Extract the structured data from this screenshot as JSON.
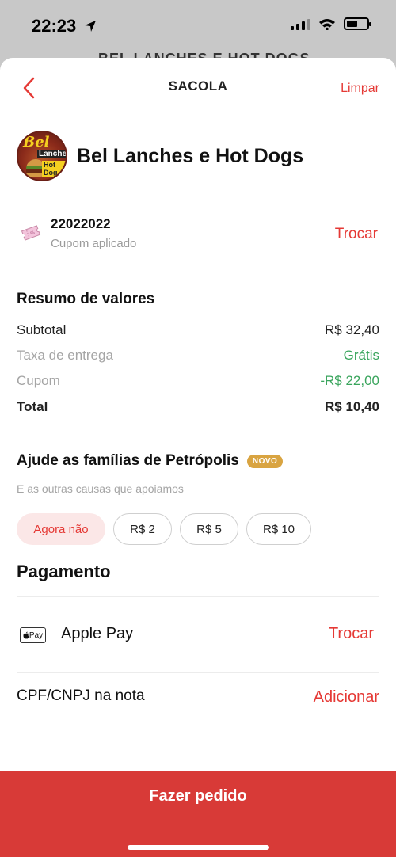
{
  "status_bar": {
    "time": "22:23"
  },
  "background_page": {
    "title": "BEL LANCHES E HOT DOGS"
  },
  "header": {
    "title": "SACOLA",
    "clear_label": "Limpar"
  },
  "store": {
    "name": "Bel Lanches e Hot Dogs",
    "logo_text": [
      "Bel",
      "Lanches",
      "Hot Dog"
    ]
  },
  "coupon": {
    "code": "22022022",
    "status": "Cupom aplicado",
    "change_label": "Trocar"
  },
  "summary": {
    "title": "Resumo de valores",
    "rows": [
      {
        "label": "Subtotal",
        "value": "R$ 32,40"
      },
      {
        "label": "Taxa de entrega",
        "value": "Grátis"
      },
      {
        "label": "Cupom",
        "value": "-R$ 22,00"
      },
      {
        "label": "Total",
        "value": "R$ 10,40"
      }
    ]
  },
  "donation": {
    "title": "Ajude as famílias de Petrópolis",
    "badge": "NOVO",
    "subtitle": "E as outras causas que apoiamos",
    "options": [
      "Agora não",
      "R$ 2",
      "R$ 5",
      "R$ 10"
    ]
  },
  "payment": {
    "title": "Pagamento",
    "icon_label": "Pay",
    "method": "Apple Pay",
    "change_label": "Trocar"
  },
  "cpf": {
    "label": "CPF/CNPJ na nota",
    "action": "Adicionar"
  },
  "order": {
    "button_label": "Fazer pedido"
  },
  "colors": {
    "accent": "#e53935",
    "order_bar": "#d83a37",
    "green": "#3aa55d",
    "badge": "#d9a441"
  }
}
